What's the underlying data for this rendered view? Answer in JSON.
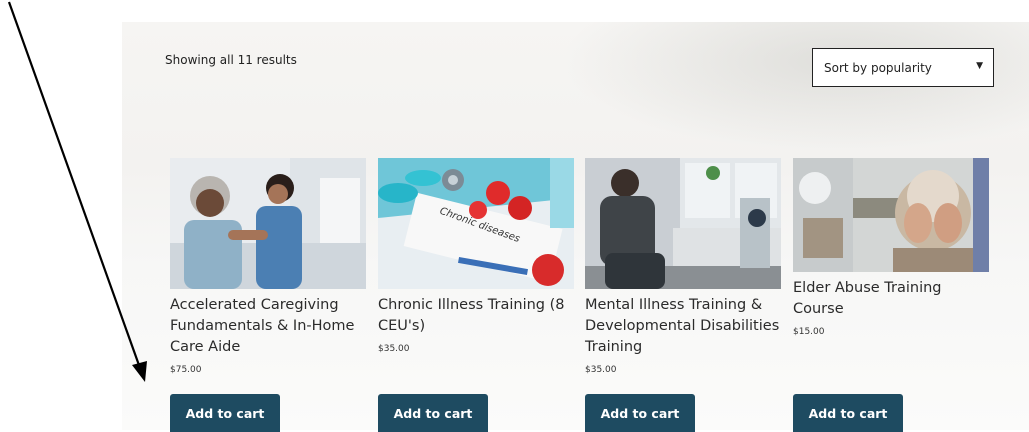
{
  "shop": {
    "result_count": "Showing all 11 results",
    "sort": {
      "selected": "Sort by popularity"
    }
  },
  "products": [
    {
      "title": "Accelerated Caregiving Fundamentals & In-Home Care Aide",
      "price": "$75.00",
      "button": "Add to cart"
    },
    {
      "title": "Chronic Illness Training (8 CEU's)",
      "price": "$35.00",
      "button": "Add to cart",
      "image_text": "Chronic diseases"
    },
    {
      "title": "Mental Illness Training & Developmental Disabilities Training",
      "price": "$35.00",
      "button": "Add to cart"
    },
    {
      "title": "Elder Abuse Training Course",
      "price": "$15.00",
      "button": "Add to cart"
    }
  ],
  "colors": {
    "button_bg": "#1e4b61",
    "button_text": "#ffffff",
    "annotation_arrow": "#000000"
  }
}
